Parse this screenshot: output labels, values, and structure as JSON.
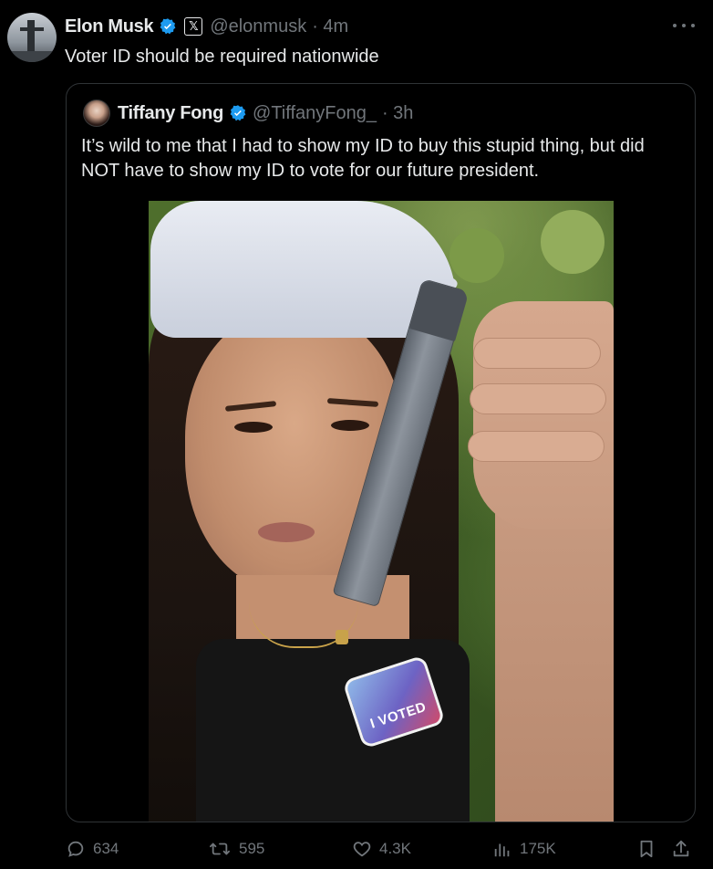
{
  "post": {
    "author": {
      "display_name": "Elon Musk",
      "handle": "@elonmusk",
      "time": "· 4m",
      "affiliate_badge": "𝕏"
    },
    "text": "Voter ID should be required nationwide",
    "more_icon": "more-horizontal-icon"
  },
  "quote": {
    "author": {
      "display_name": "Tiffany Fong",
      "handle": "@TiffanyFong_",
      "time": "· 3h"
    },
    "text": "It’s wild to me that I had to show my ID to buy this stupid thing, but did NOT have to show my ID to vote for our future president.",
    "photo": {
      "sticker_text": "I VOTED"
    }
  },
  "actions": {
    "replies": "634",
    "reposts": "595",
    "likes": "4.3K",
    "views": "175K"
  },
  "colors": {
    "background": "#000000",
    "text": "#e7e9ea",
    "muted": "#71767b",
    "verified": "#1d9bf0",
    "border": "#2f3336"
  }
}
